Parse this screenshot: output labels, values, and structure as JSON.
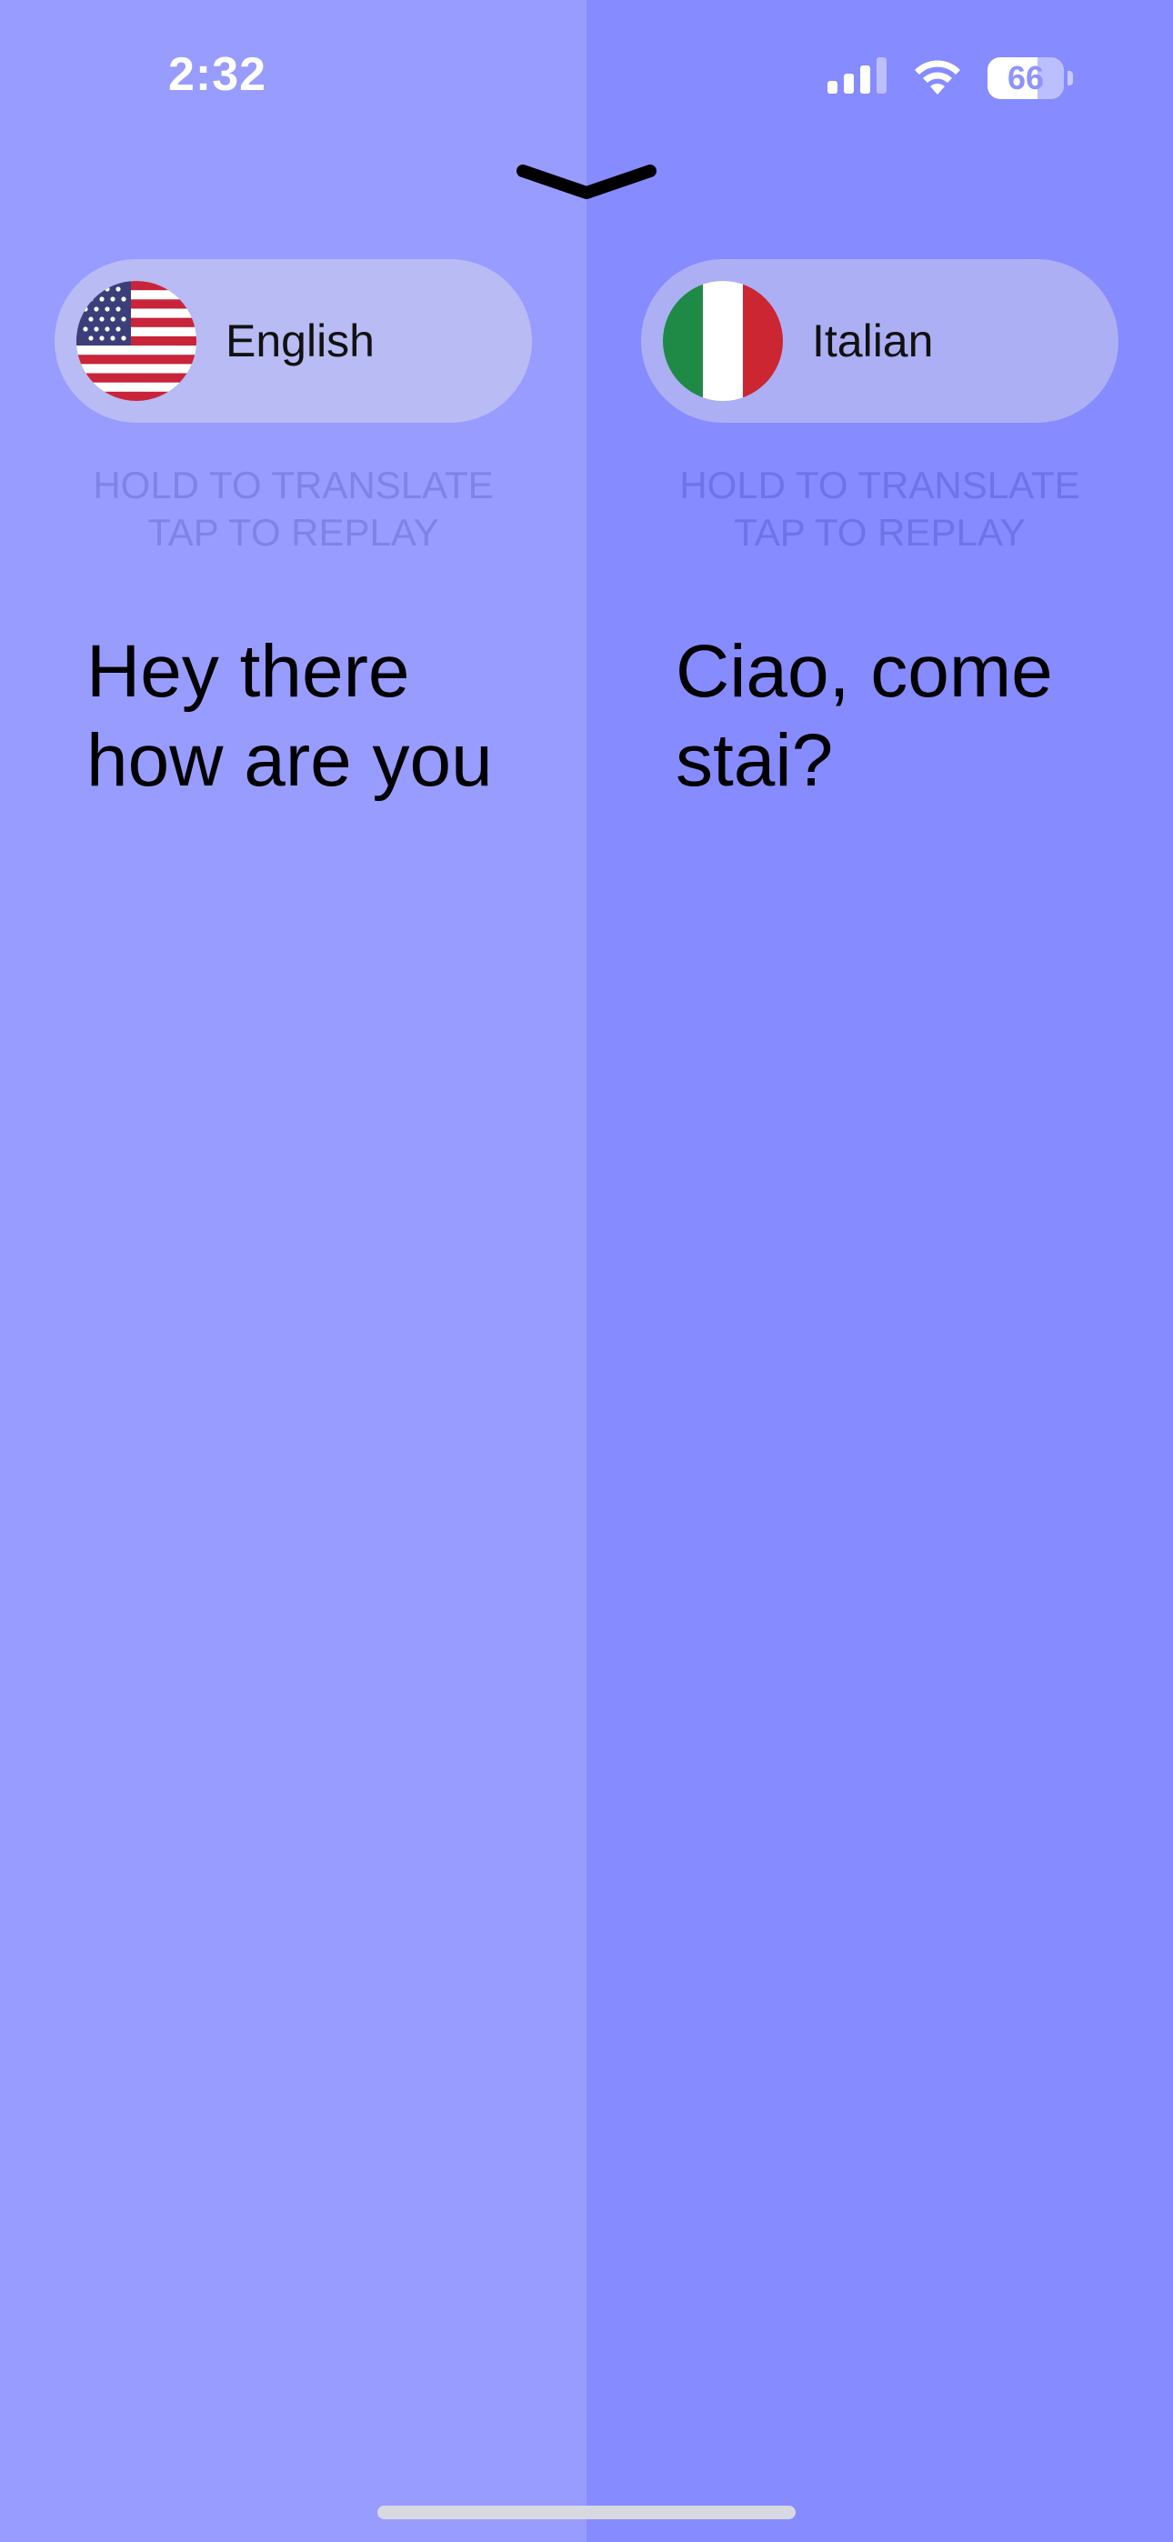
{
  "status_bar": {
    "time": "2:32",
    "battery_level": "66",
    "icons": [
      "cellular-signal-icon",
      "wifi-icon",
      "battery-icon"
    ]
  },
  "header": {
    "collapse_icon": "chevron-down-icon"
  },
  "left_panel": {
    "language": "English",
    "flag": "us-flag-icon",
    "hint_line1": "HOLD TO TRANSLATE",
    "hint_line2": "TAP TO REPLAY",
    "phrase": "Hey there how are you"
  },
  "right_panel": {
    "language": "Italian",
    "flag": "italy-flag-icon",
    "hint_line1": "HOLD TO TRANSLATE",
    "hint_line2": "TAP TO REPLAY",
    "phrase": "Ciao, come stai?"
  },
  "colors": {
    "left_background": "#989cff",
    "right_background": "#868bff",
    "pill_left": "#b8bbf4",
    "pill_right": "#adaff4"
  }
}
